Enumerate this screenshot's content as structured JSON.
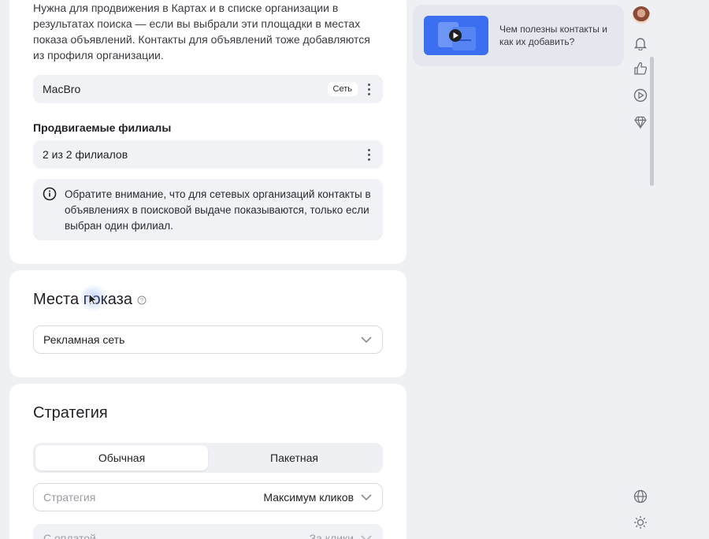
{
  "contacts": {
    "description": "Нужна для продвижения в Картах и в списке организации в результатах поиска — если вы выбрали эти площадки в местах показа объявлений. Контакты для объявлений тоже добавляются из профиля организации.",
    "org_name": "MacBro",
    "org_badge": "Сеть",
    "branches_title": "Продвигаемые филиалы",
    "branches_value": "2 из 2 филиалов",
    "notice": "Обратите внимание, что для сетевых организаций контакты в объявлениях в поисковой выдаче показываются, только если выбран один филиал."
  },
  "places": {
    "title": "Места показа",
    "selected": "Рекламная сеть"
  },
  "strategy": {
    "title": "Стратегия",
    "tabs": [
      {
        "label": "Обычная",
        "active": true
      },
      {
        "label": "Пакетная",
        "active": false
      }
    ],
    "strategy_key": "Стратегия",
    "strategy_value": "Максимум кликов",
    "payment_key": "С оплатой",
    "payment_value": "За клики"
  },
  "promo": {
    "text": "Чем полезны контакты и как их добавить?"
  },
  "rail": {
    "icons": [
      "avatar",
      "bell-icon",
      "thumbs-up-icon",
      "play-circle-icon",
      "diamond-icon",
      "globe-icon",
      "sun-icon"
    ]
  },
  "colors": {
    "accent": "#3b6ff0",
    "background": "#eef0f4",
    "card": "#ffffff"
  }
}
